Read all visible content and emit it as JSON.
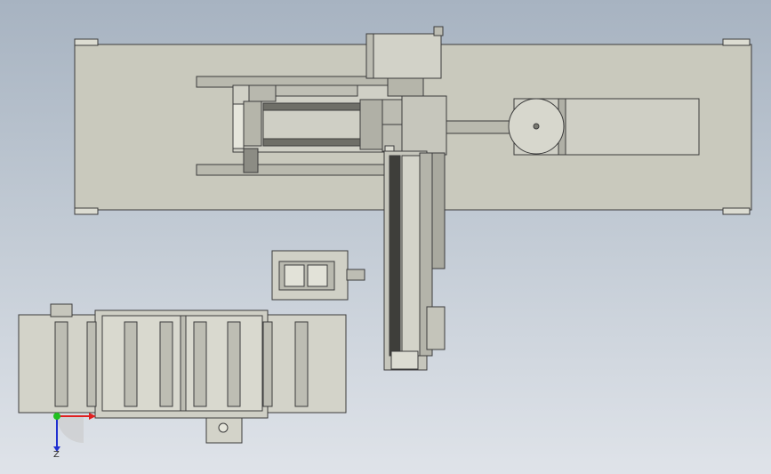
{
  "app": {
    "title": ""
  },
  "viewport": {
    "background_top": "#a7b3c1",
    "background_bottom": "#dfe3e9",
    "part_fill": "#c9c9bd",
    "part_dark": "#9f9f95",
    "edge_color": "#3c3c3c"
  },
  "triad": {
    "x_color": "#e02020",
    "y_color": "#20c020",
    "z_color": "#2030d0",
    "z_label": "Z"
  },
  "model": {
    "components": [
      "base-plate",
      "gantry-carriage",
      "z-axis-module",
      "linear-rail-vertical",
      "drive-roller",
      "fixture-plate",
      "tray-conveyor"
    ]
  }
}
